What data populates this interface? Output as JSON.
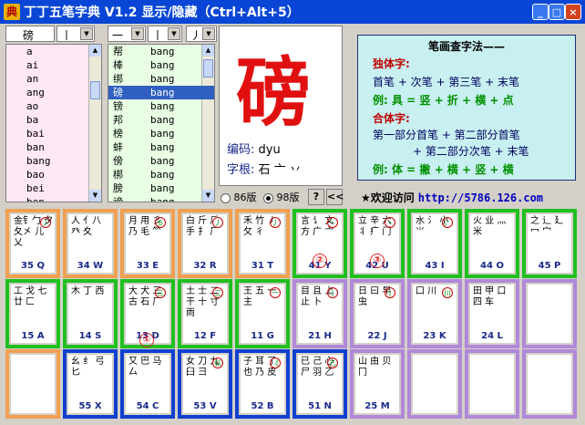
{
  "window": {
    "title": "丁丁五笔字典 V1.2  显示/隐藏（Ctrl+Alt+5）",
    "icon_char": "典",
    "btn_min": "_",
    "btn_max": "□",
    "btn_close": "×"
  },
  "search": {
    "char_value": "磅",
    "stroke1": "丨",
    "stroke2": "一",
    "stroke3": "丨",
    "stroke4": "丿"
  },
  "pinyin_list": [
    "a",
    "ai",
    "an",
    "ang",
    "ao",
    "ba",
    "bai",
    "ban",
    "bang",
    "bao",
    "bei",
    "ben",
    "beng"
  ],
  "char_list": [
    {
      "ch": "帮",
      "py": "bang"
    },
    {
      "ch": "棒",
      "py": "bang"
    },
    {
      "ch": "绑",
      "py": "bang"
    },
    {
      "ch": "磅",
      "py": "bang"
    },
    {
      "ch": "镑",
      "py": "bang"
    },
    {
      "ch": "邦",
      "py": "bang"
    },
    {
      "ch": "榜",
      "py": "bang"
    },
    {
      "ch": "蚌",
      "py": "bang"
    },
    {
      "ch": "傍",
      "py": "bang"
    },
    {
      "ch": "梆",
      "py": "bang"
    },
    {
      "ch": "膀",
      "py": "bang"
    },
    {
      "ch": "谤",
      "py": "bang"
    },
    {
      "ch": "浜",
      "py": "bang"
    }
  ],
  "selected_char": {
    "char": "磅",
    "code_label": "编码:",
    "code_value": "dyu",
    "root_label": "字根:",
    "root_value": "石 亠 丷"
  },
  "version": {
    "opt86": "86版",
    "opt98": "98版",
    "help_label": "?",
    "collapse_label": "<<"
  },
  "method": {
    "title": "笔画查字法——",
    "lines": [
      "独体字:",
      "首笔 + 次笔 + 第三笔 + 末笔",
      "例: 具 = 竖 + 折 + 横 + 点",
      "合体字:",
      "第一部分首笔 + 第二部分首笔",
      "+ 第二部分次笔 + 末笔",
      "例: 体 = 撇 + 横 + 竖 + 横"
    ]
  },
  "welcome": {
    "text": "★欢迎访问",
    "url": "http://5786.126.com"
  },
  "keyboard": {
    "row1": [
      {
        "radical": "金钅勹 夕夂㐅 儿 乂",
        "label": "35 Q",
        "circ": "丿"
      },
      {
        "radical": "人 亻八 癶 夊",
        "label": "34 W",
        "circ": ""
      },
      {
        "radical": "月 用 彡 乃 毛 ⺮",
        "label": "33 E",
        "circ": "彡"
      },
      {
        "radical": "白 斤 ⺁ 手 扌 厂",
        "label": "32 R",
        "circ": "丿"
      },
      {
        "radical": "禾 竹 丿 攵 彳",
        "label": "31 T",
        "circ": "丿"
      },
      {
        "radical": "言 讠 文 方 广 亠",
        "label": "41 Y",
        "circ": "丶"
      },
      {
        "radical": "立 辛 六 丬 疒 门",
        "label": "42 U",
        "circ": "丶"
      },
      {
        "radical": "水 氵 小 ⺌",
        "label": "43 I",
        "circ": "氵"
      },
      {
        "radical": "火 业 灬 米",
        "label": "44 O",
        "circ": ""
      },
      {
        "radical": "之 辶 廴 冖 宀",
        "label": "45 P",
        "circ": ""
      }
    ],
    "row2": [
      {
        "radical": "工 戈 七 廿 匚",
        "label": "15 A",
        "circ": ""
      },
      {
        "radical": "木 丁 西",
        "label": "14 S",
        "circ": ""
      },
      {
        "radical": "大 犬 三 古 石 厂",
        "label": "13 D",
        "circ": "三"
      },
      {
        "radical": "土 士 二 干 十 寸 雨",
        "label": "12 F",
        "circ": "二"
      },
      {
        "radical": "王 五 一 主",
        "label": "11 G",
        "circ": "一"
      },
      {
        "radical": "目 且 上 止 卜",
        "label": "21 H",
        "circ": "丨"
      },
      {
        "radical": "日 曰 早 虫",
        "label": "22 J",
        "circ": "丨"
      },
      {
        "radical": "口 川",
        "label": "23 K",
        "circ": "川"
      },
      {
        "radical": "田 甲 口 四 车",
        "label": "24 L",
        "circ": ""
      },
      {
        "radical": "",
        "label": "",
        "circ": ""
      }
    ],
    "row3": [
      {
        "radical": "",
        "label": "",
        "circ": ""
      },
      {
        "radical": "幺 纟 弓 匕",
        "label": "55 X",
        "circ": ""
      },
      {
        "radical": "又 巴 马 厶",
        "label": "54 C",
        "circ": ""
      },
      {
        "radical": "女 刀 九 臼 彐",
        "label": "53 V",
        "circ": "巛"
      },
      {
        "radical": "子 耳 了 也 乃 皮",
        "label": "52 B",
        "circ": "《"
      },
      {
        "radical": "已 己 心 尸 羽 乙",
        "label": "51 N",
        "circ": "乙"
      },
      {
        "radical": "山 由 贝 冂",
        "label": "25 M",
        "circ": ""
      },
      {
        "radical": "",
        "label": "",
        "circ": ""
      },
      {
        "radical": "",
        "label": "",
        "circ": ""
      },
      {
        "radical": "",
        "label": "",
        "circ": ""
      }
    ]
  },
  "marks": [
    "①",
    "②",
    "③"
  ]
}
